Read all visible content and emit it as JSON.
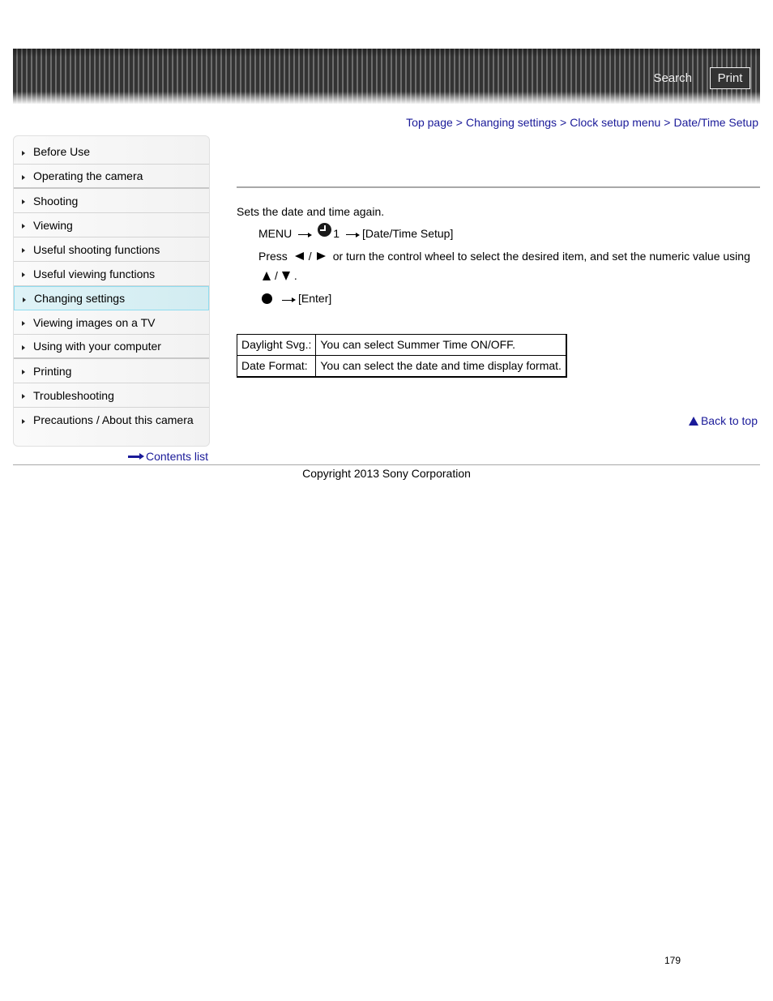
{
  "header": {
    "search_label": "Search",
    "print_label": "Print"
  },
  "breadcrumb": [
    {
      "label": "Top page"
    },
    {
      "label": "Changing settings"
    },
    {
      "label": "Clock setup menu"
    },
    {
      "label": "Date/Time Setup"
    }
  ],
  "breadcrumb_separator": ">",
  "sidebar": {
    "items": [
      {
        "label": "Before Use",
        "active": false
      },
      {
        "label": "Operating the camera",
        "active": false
      },
      {
        "label": "Shooting",
        "active": false
      },
      {
        "label": "Viewing",
        "active": false
      },
      {
        "label": "Useful shooting functions",
        "active": false
      },
      {
        "label": "Useful viewing functions",
        "active": false
      },
      {
        "label": "Changing settings",
        "active": true
      },
      {
        "label": "Viewing images on a TV",
        "active": false
      },
      {
        "label": "Using with your computer",
        "active": false
      },
      {
        "label": "Printing",
        "active": false
      },
      {
        "label": "Troubleshooting",
        "active": false
      },
      {
        "label": "Precautions / About this camera",
        "active": false
      }
    ],
    "contents_list_label": "Contents list"
  },
  "content": {
    "intro": "Sets the date and time again.",
    "step1": {
      "menu": "MENU",
      "tab_number": "1",
      "target": "[Date/Time Setup]",
      "icon": "clock-icon"
    },
    "step2": {
      "press": "Press",
      "slash": "/",
      "text": "or turn the control wheel to select the desired item, and set the numeric value using",
      "period": "."
    },
    "step3": {
      "target": "[Enter]"
    },
    "table": [
      {
        "label": "Daylight Svg.:",
        "description": "You can select Summer Time ON/OFF."
      },
      {
        "label": "Date Format:",
        "description": "You can select the date and time display format."
      }
    ],
    "back_to_top_label": "Back to top"
  },
  "footer": {
    "copyright": "Copyright 2013 Sony Corporation",
    "page_number": "179"
  },
  "colors": {
    "link": "#1a1a99",
    "active_nav_bg": "#d9f0f4",
    "active_nav_border": "#8fdcef"
  }
}
